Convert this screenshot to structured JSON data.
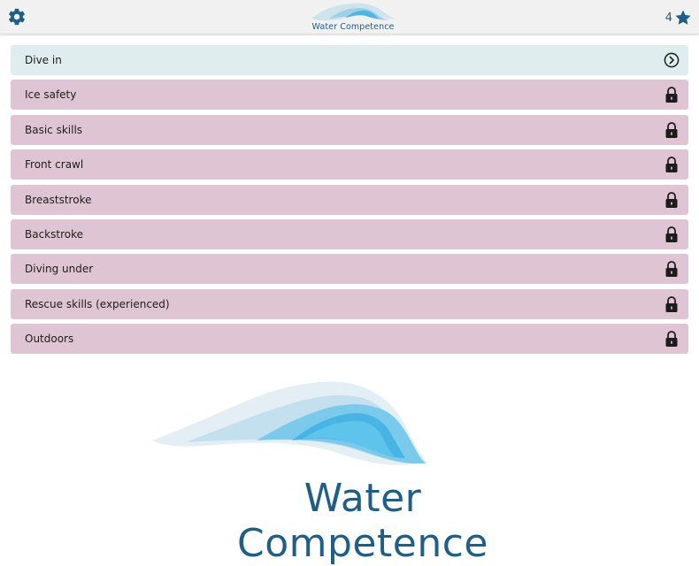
{
  "header": {
    "app_name": "Water Competence",
    "stars_count": "4",
    "settings_icon": "gear-icon",
    "star_icon": "star-icon"
  },
  "colors": {
    "accent": "#1f5f86",
    "active_row": "#dfedee",
    "locked_row": "#dfc5d3",
    "header_bg": "#f1f1f1"
  },
  "modules": [
    {
      "label": "Dive in",
      "state": "open",
      "icon": "chevron-circle-right-icon"
    },
    {
      "label": "Ice safety",
      "state": "locked",
      "icon": "lock-icon"
    },
    {
      "label": "Basic skills",
      "state": "locked",
      "icon": "lock-icon"
    },
    {
      "label": "Front crawl",
      "state": "locked",
      "icon": "lock-icon"
    },
    {
      "label": "Breaststroke",
      "state": "locked",
      "icon": "lock-icon"
    },
    {
      "label": "Backstroke",
      "state": "locked",
      "icon": "lock-icon"
    },
    {
      "label": "Diving under",
      "state": "locked",
      "icon": "lock-icon"
    },
    {
      "label": "Rescue skills (experienced)",
      "state": "locked",
      "icon": "lock-icon"
    },
    {
      "label": "Outdoors",
      "state": "locked",
      "icon": "lock-icon"
    }
  ],
  "logo": {
    "title": "Water Competence"
  }
}
